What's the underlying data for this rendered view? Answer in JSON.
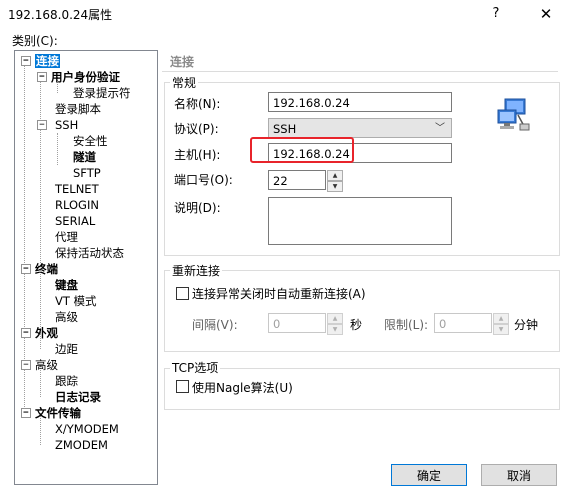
{
  "window": {
    "title": "192.168.0.24属性",
    "help_glyph": "?",
    "close_glyph": "✕"
  },
  "category_label": "类别(C):",
  "tree": [
    {
      "label": "连接",
      "expander": "−"
    },
    {
      "label": "用户身份验证",
      "expander": "−"
    },
    {
      "label": "登录提示符"
    },
    {
      "label": "登录脚本"
    },
    {
      "label": "SSH",
      "expander": "−"
    },
    {
      "label": "安全性"
    },
    {
      "label": "隧道"
    },
    {
      "label": "SFTP"
    },
    {
      "label": "TELNET"
    },
    {
      "label": "RLOGIN"
    },
    {
      "label": "SERIAL"
    },
    {
      "label": "代理"
    },
    {
      "label": "保持活动状态"
    },
    {
      "label": "终端",
      "expander": "−"
    },
    {
      "label": "键盘"
    },
    {
      "label": "VT 模式"
    },
    {
      "label": "高级"
    },
    {
      "label": "外观",
      "expander": "−"
    },
    {
      "label": "边距"
    },
    {
      "label": "高级",
      "expander": "−"
    },
    {
      "label": "跟踪"
    },
    {
      "label": "日志记录"
    },
    {
      "label": "文件传输",
      "expander": "−"
    },
    {
      "label": "X/YMODEM"
    },
    {
      "label": "ZMODEM"
    }
  ],
  "panel": {
    "title": "连接",
    "general": {
      "title": "常规",
      "name_label": "名称(N):",
      "name_value": "192.168.0.24",
      "protocol_label": "协议(P):",
      "protocol_value": "SSH",
      "protocol_arrow": "﹀",
      "host_label": "主机(H):",
      "host_value": "192.168.0.24",
      "port_label": "端口号(O):",
      "port_value": "22",
      "desc_label": "说明(D):",
      "desc_value": ""
    },
    "reconnect": {
      "title": "重新连接",
      "auto_label": "连接异常关闭时自动重新连接(A)",
      "interval_label": "间隔(V):",
      "interval_value": "0",
      "sec_unit": "秒",
      "limit_label": "限制(L):",
      "limit_value": "0",
      "min_unit": "分钟"
    },
    "tcp": {
      "title": "TCP选项",
      "nagle_label": "使用Nagle算法(U)"
    }
  },
  "buttons": {
    "ok": "确定",
    "cancel": "取消"
  },
  "spin": {
    "up": "▲",
    "down": "▼"
  },
  "colors": {
    "highlight": "#e8242b",
    "selection": "#0078d7"
  }
}
